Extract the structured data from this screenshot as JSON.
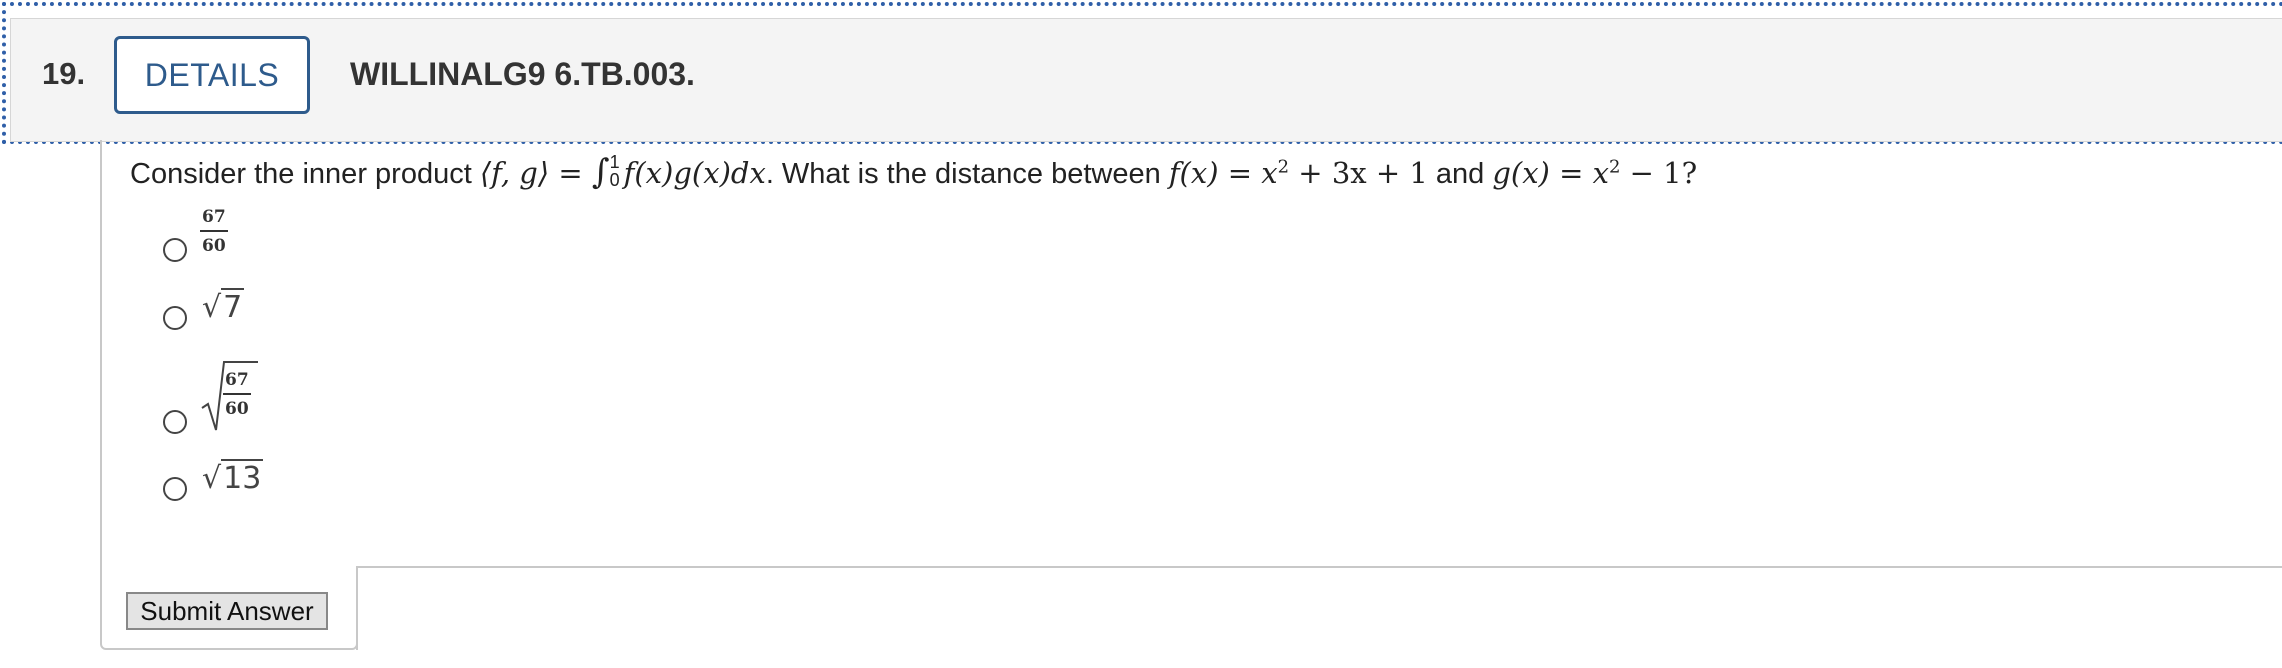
{
  "header": {
    "number": "19.",
    "details_label": "DETAILS",
    "code": "WILLINALG9 6.TB.003."
  },
  "question": {
    "lead": "Consider the inner product ",
    "ip": "⟨f, g⟩",
    "eq": " = ",
    "int_upper": "1",
    "int_lower": "0",
    "integrand": "f(x)g(x)dx",
    "mid": ". What is the distance between ",
    "f_expr": "f(x) = x",
    "f_rest": " + 3x + 1",
    "and": " and ",
    "g_expr": "g(x) = x",
    "g_rest": " − 1?",
    "sq": "2"
  },
  "options": [
    {
      "num": "67",
      "den": "60"
    },
    {
      "radicand": "7"
    },
    {
      "num": "67",
      "den": "60"
    },
    {
      "radicand": "13"
    }
  ],
  "submit_label": "Submit Answer"
}
